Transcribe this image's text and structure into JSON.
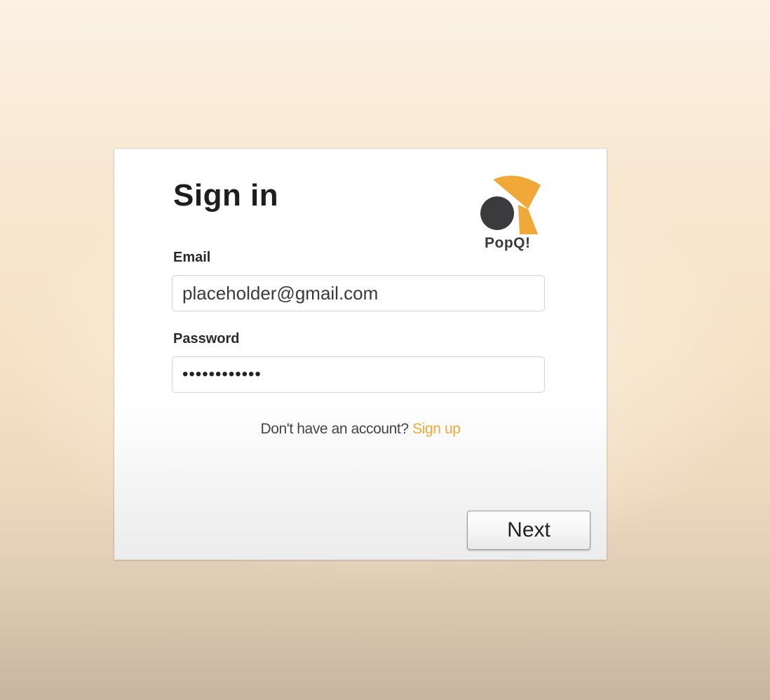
{
  "signin": {
    "title": "Sign in",
    "logo": {
      "text": "PopQ!",
      "icon": "popq-logo-icon",
      "colors": {
        "circle": "#3b3b3d",
        "accent": "#f0a838"
      }
    },
    "email": {
      "label": "Email",
      "value": "placeholder@gmail.com"
    },
    "password": {
      "label": "Password",
      "masked_value": "••••••••••••"
    },
    "signup_prompt": {
      "text": "Don't have an account?",
      "link": "Sign up"
    },
    "next_label": "Next"
  },
  "colors": {
    "accent": "#f0a838",
    "title": "#1e1e1e"
  }
}
